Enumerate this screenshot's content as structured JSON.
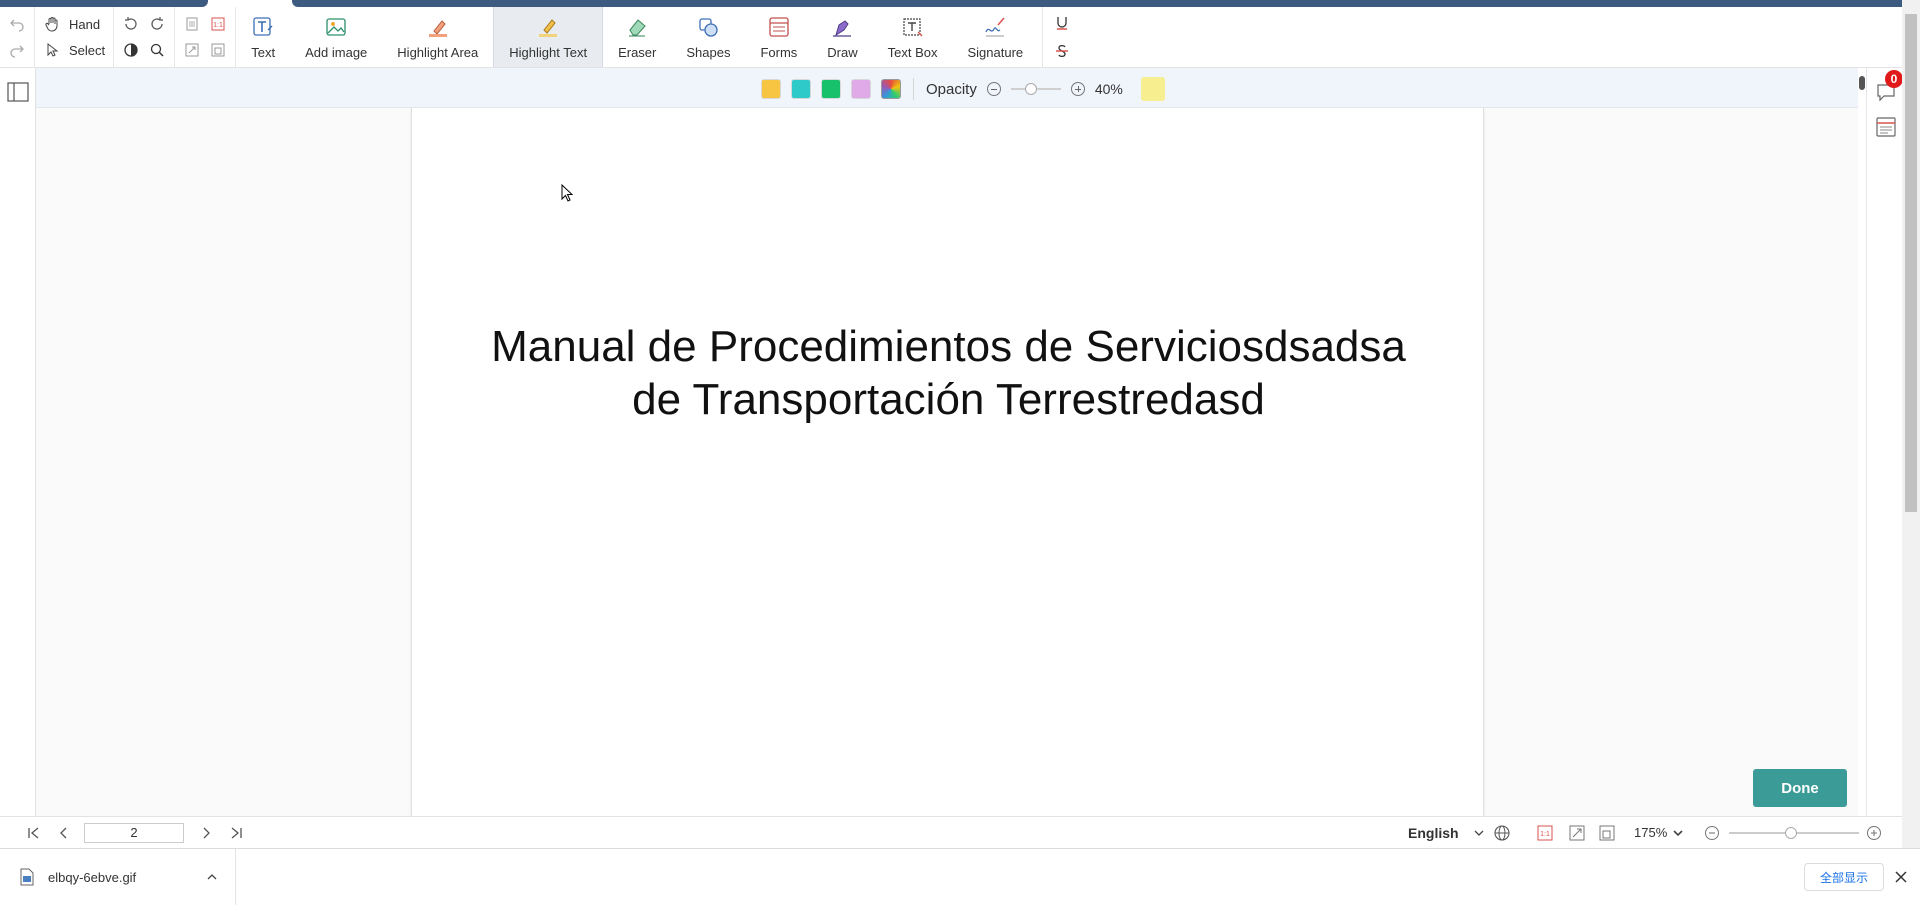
{
  "toolbar": {
    "hand_label": "Hand",
    "select_label": "Select",
    "tools": [
      {
        "label": "Text",
        "icon": "text-tool-icon"
      },
      {
        "label": "Add image",
        "icon": "image-icon"
      },
      {
        "label": "Highlight Area",
        "icon": "highlight-area-icon"
      },
      {
        "label": "Highlight Text",
        "icon": "highlight-text-icon",
        "active": true
      },
      {
        "label": "Eraser",
        "icon": "eraser-icon"
      },
      {
        "label": "Shapes",
        "icon": "shapes-icon"
      },
      {
        "label": "Forms",
        "icon": "forms-icon"
      },
      {
        "label": "Draw",
        "icon": "draw-icon"
      },
      {
        "label": "Text Box",
        "icon": "text-box-icon"
      },
      {
        "label": "Signature",
        "icon": "signature-icon"
      }
    ],
    "mini_labels": {
      "fit": "1:1"
    }
  },
  "highlight_bar": {
    "colors": [
      "#f7c541",
      "#2ec9c9",
      "#17c06b",
      "#e0a9e8"
    ],
    "selected_color": "#f6ee8f",
    "opacity_label": "Opacity",
    "opacity_value": "40%",
    "opacity_fraction": 0.4
  },
  "document": {
    "title_line1": "Manual de Procedimientos de Serviciosdsadsa",
    "title_line2": "de Transportación Terrestredasd"
  },
  "done_label": "Done",
  "comments_badge": "0",
  "status": {
    "page_number": "2",
    "language": "English",
    "zoom": "175%",
    "zoom_fraction": 0.48
  },
  "download": {
    "filename": "elbqy-6ebve.gif",
    "show_all": "全部显示"
  },
  "accent": "#3a9b97",
  "brand": "#3d5a80"
}
